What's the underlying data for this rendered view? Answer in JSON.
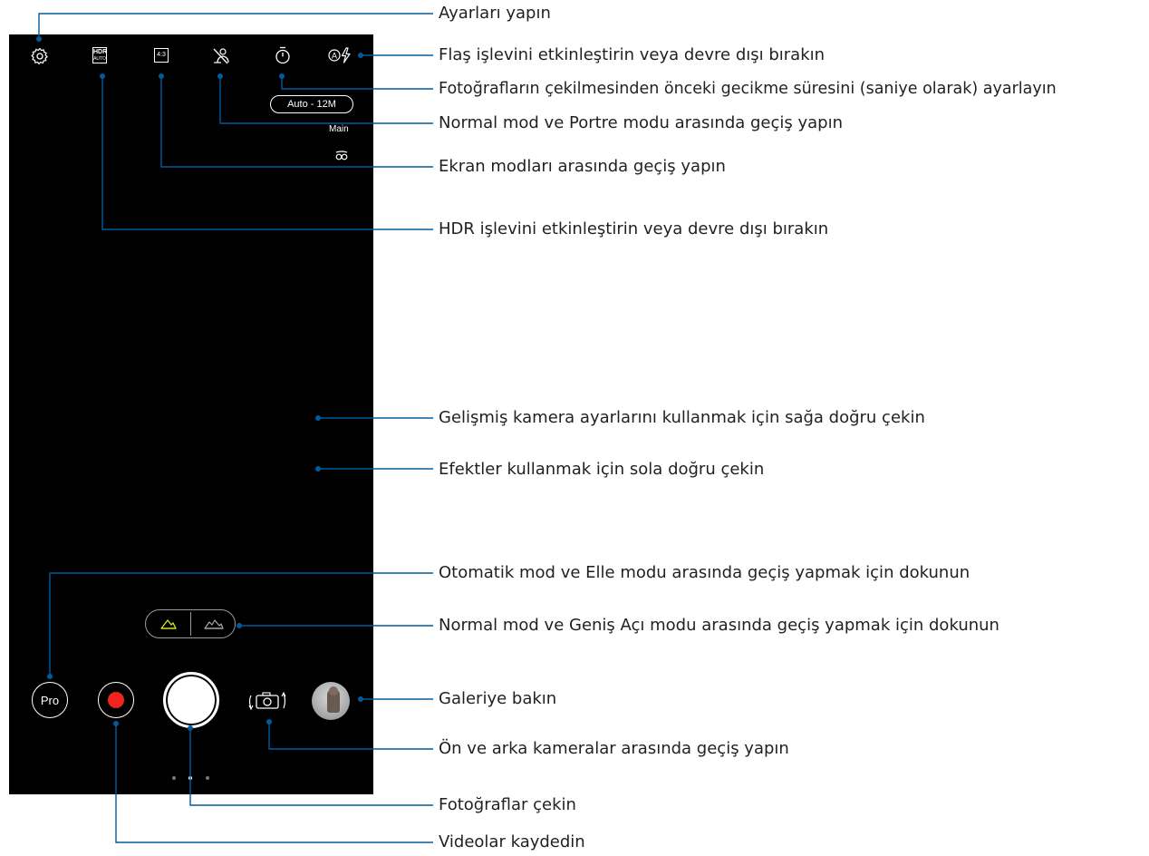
{
  "screen": {
    "resolution_badge": "Auto - 12M",
    "camera_label": "Main",
    "pro_button_label": "Pro",
    "hdr_icon_top": "HDR",
    "hdr_icon_bottom": "AUTO",
    "aspect_icon": "4:3"
  },
  "callouts": [
    {
      "id": "settings",
      "text": "Ayarları yapın"
    },
    {
      "id": "flash",
      "text": "Flaş işlevini etkinleştirin veya devre dışı bırakın"
    },
    {
      "id": "timer",
      "text": "Fotoğrafların çekilmesinden önceki gecikme süresini (saniye olarak) ayarlayın"
    },
    {
      "id": "portrait",
      "text": "Normal mod ve Portre modu arasında geçiş yapın"
    },
    {
      "id": "screen_mode",
      "text": "Ekran modları arasında geçiş yapın"
    },
    {
      "id": "hdr",
      "text": "HDR işlevini etkinleştirin veya devre dışı bırakın"
    },
    {
      "id": "swipe_right",
      "text": "Gelişmiş kamera ayarlarını kullanmak için sağa doğru çekin"
    },
    {
      "id": "swipe_left",
      "text": "Efektler kullanmak için sola doğru çekin"
    },
    {
      "id": "manual_mode",
      "text": "Otomatik mod ve Elle modu arasında geçiş yapmak için dokunun"
    },
    {
      "id": "wide_angle",
      "text": "Normal mod ve Geniş Açı modu arasında geçiş yapmak için dokunun"
    },
    {
      "id": "gallery",
      "text": "Galeriye bakın"
    },
    {
      "id": "switch_camera",
      "text": "Ön ve arka kameralar arasında geçiş yapın"
    },
    {
      "id": "take_photo",
      "text": "Fotoğraflar çekin"
    },
    {
      "id": "record_video",
      "text": "Videolar kaydedin"
    }
  ],
  "colors": {
    "leader_line": "#005a9c",
    "background": "#000000",
    "record_red": "#f0231e",
    "lens_active": "#d7e81a"
  },
  "icons": [
    "settings-gear-icon",
    "hdr-auto-icon",
    "aspect-ratio-icon",
    "portrait-off-icon",
    "timer-icon",
    "flash-auto-icon",
    "beauty-owl-icon",
    "normal-lens-icon",
    "wide-lens-icon",
    "switch-camera-icon"
  ]
}
